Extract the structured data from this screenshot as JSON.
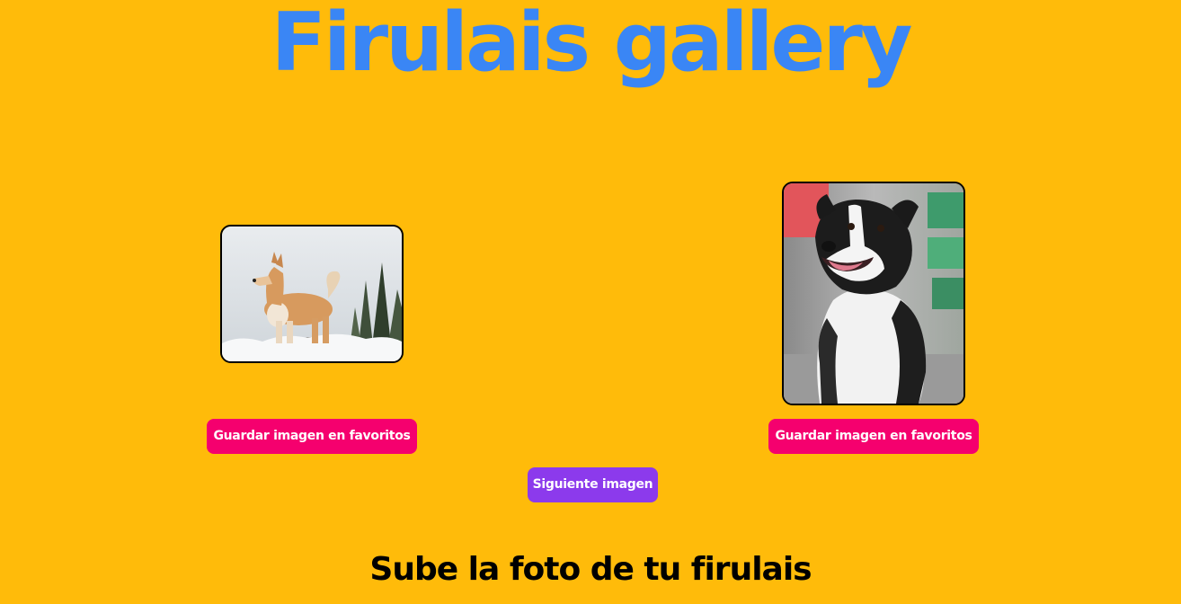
{
  "header": {
    "title": "Firulais gallery"
  },
  "gallery": {
    "images": [
      {
        "icon": "akita-dog-photo",
        "favorite_label": "Guardar imagen en favoritos"
      },
      {
        "icon": "border-collie-dog-photo",
        "favorite_label": "Guardar imagen en favoritos"
      }
    ],
    "next_label": "Siguiente imagen"
  },
  "upload": {
    "heading": "Sube la foto de tu firulais"
  },
  "colors": {
    "background": "#FFBB0A",
    "title": "#3A86F5",
    "favorite_button": "#F5006E",
    "next_button": "#8C3AEC"
  }
}
